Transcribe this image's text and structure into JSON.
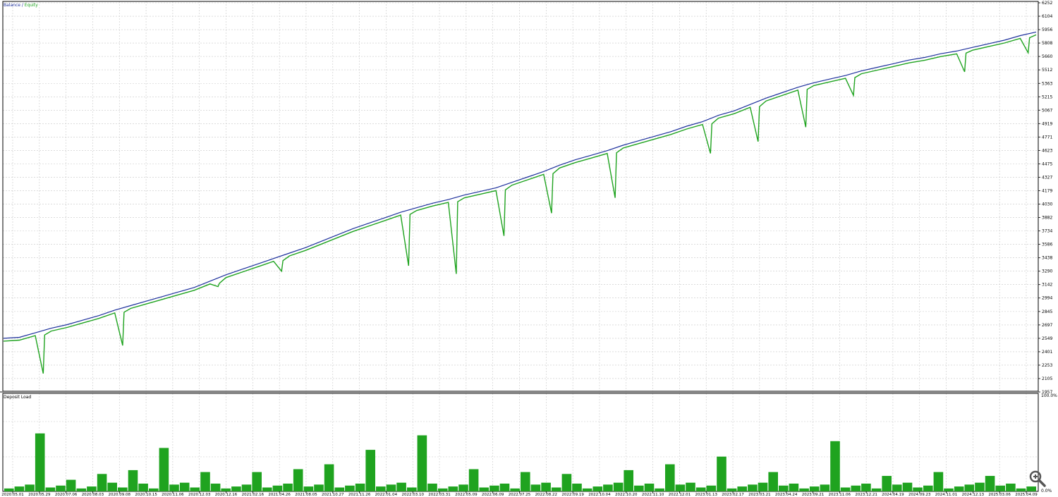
{
  "legend": {
    "balance": "Balance",
    "separator": " / ",
    "equity": "Equity"
  },
  "subwindow_label": "Deposit Load",
  "colors": {
    "balance": "#1c2f9c",
    "equity": "#1fa31f",
    "grid": "#c8c8c8",
    "axis": "#000000",
    "load": "#1fa31f"
  },
  "chart_data": [
    {
      "type": "line",
      "series": [
        {
          "name": "Balance",
          "color": "#1c2f9c"
        },
        {
          "name": "Equity",
          "color": "#1fa31f"
        }
      ],
      "xticks": [
        "2020.05.01",
        "2020.05.29",
        "2020.07.06",
        "2020.08.03",
        "2020.09.08",
        "2020.10.15",
        "2020.11.06",
        "2020.12.03",
        "2020.12.16",
        "2021.02.16",
        "2021.04.26",
        "2021.08.05",
        "2021.10.27",
        "2021.11.26",
        "2022.01.04",
        "2022.03.10",
        "2022.03.31",
        "2022.05.09",
        "2022.06.09",
        "2022.07.25",
        "2022.08.22",
        "2022.09.19",
        "2022.10.04",
        "2022.10.20",
        "2022.11.10",
        "2022.12.01",
        "2023.01.13",
        "2023.02.17",
        "2023.03.21",
        "2023.04.24",
        "2023.09.21",
        "2023.11.06",
        "2023.12.21",
        "2024.04.19",
        "2024.09.23",
        "2024.11.01",
        "2024.12.13",
        "2025.03.06",
        "2025.04.09"
      ],
      "yticks": [
        6252,
        6104,
        5956,
        5808,
        5660,
        5512,
        5363,
        5215,
        5067,
        4919,
        4771,
        4623,
        4475,
        4327,
        4179,
        4030,
        3882,
        3734,
        3586,
        3438,
        3290,
        3142,
        2994,
        2845,
        2697,
        2549,
        2401,
        2253,
        2105,
        1957
      ],
      "ylim": [
        1957,
        6252
      ],
      "balance": [
        2549,
        2560,
        2610,
        2660,
        2700,
        2750,
        2800,
        2860,
        2910,
        2960,
        3010,
        3060,
        3110,
        3180,
        3250,
        3310,
        3370,
        3430,
        3490,
        3550,
        3620,
        3690,
        3760,
        3820,
        3880,
        3940,
        3990,
        4040,
        4080,
        4130,
        4170,
        4210,
        4270,
        4330,
        4390,
        4460,
        4520,
        4570,
        4620,
        4680,
        4730,
        4780,
        4830,
        4890,
        4940,
        5010,
        5060,
        5130,
        5200,
        5260,
        5320,
        5370,
        5410,
        5450,
        5500,
        5540,
        5580,
        5620,
        5650,
        5690,
        5720,
        5760,
        5800,
        5840,
        5890,
        5930
      ],
      "equity_drawdowns": [
        {
          "index": 2,
          "value": 2160
        },
        {
          "index": 7,
          "value": 2470
        },
        {
          "index": 13,
          "value": 3120
        },
        {
          "index": 17,
          "value": 3290
        },
        {
          "index": 25,
          "value": 3350
        },
        {
          "index": 28,
          "value": 3260
        },
        {
          "index": 31,
          "value": 3680
        },
        {
          "index": 34,
          "value": 3930
        },
        {
          "index": 38,
          "value": 4100
        },
        {
          "index": 44,
          "value": 4590
        },
        {
          "index": 47,
          "value": 4720
        },
        {
          "index": 50,
          "value": 4880
        },
        {
          "index": 53,
          "value": 5230
        },
        {
          "index": 60,
          "value": 5490
        },
        {
          "index": 64,
          "value": 5700
        }
      ]
    },
    {
      "type": "bar",
      "name": "Deposit Load",
      "yticks": [
        "100.0%",
        "0.0%"
      ],
      "ylim": [
        0,
        100
      ],
      "peaks": [
        {
          "index": 3,
          "value": 60
        },
        {
          "index": 6,
          "value": 12
        },
        {
          "index": 9,
          "value": 18
        },
        {
          "index": 12,
          "value": 22
        },
        {
          "index": 15,
          "value": 45
        },
        {
          "index": 19,
          "value": 20
        },
        {
          "index": 24,
          "value": 20
        },
        {
          "index": 28,
          "value": 23
        },
        {
          "index": 31,
          "value": 28
        },
        {
          "index": 35,
          "value": 43
        },
        {
          "index": 40,
          "value": 58
        },
        {
          "index": 45,
          "value": 23
        },
        {
          "index": 50,
          "value": 20
        },
        {
          "index": 54,
          "value": 18
        },
        {
          "index": 60,
          "value": 22
        },
        {
          "index": 64,
          "value": 28
        },
        {
          "index": 69,
          "value": 36
        },
        {
          "index": 74,
          "value": 20
        },
        {
          "index": 80,
          "value": 52
        },
        {
          "index": 85,
          "value": 16
        },
        {
          "index": 90,
          "value": 20
        },
        {
          "index": 95,
          "value": 16
        }
      ]
    }
  ]
}
